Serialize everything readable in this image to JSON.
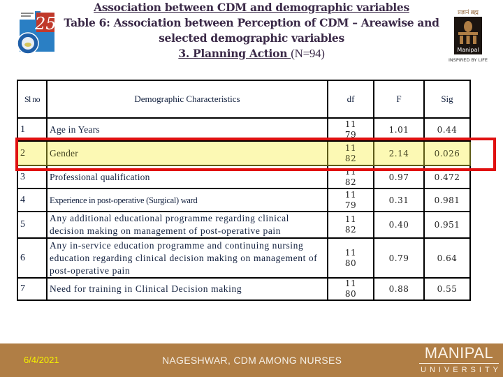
{
  "header": {
    "line1": "Association between CDM and demographic variables",
    "line2": "Table 6: Association between Perception of CDM – Areawise  and",
    "line3": "selected demographic variables",
    "line4_underlined": "3. Planning Action ",
    "line4_n": "(N=94)",
    "logo_left_number": "25",
    "logo_right_top": "प्रज्ञानं ब्रह्म",
    "logo_right_name": "Manipal",
    "logo_right_tagline": "INSPIRED BY LIFE"
  },
  "table": {
    "columns": [
      "Sl no",
      "Demographic Characteristics",
      "df",
      "F",
      "Sig"
    ],
    "rows": [
      {
        "sl": "1",
        "characteristic": "Age in Years",
        "df1": "11",
        "df2": "79",
        "F": "1.01",
        "sig": "0.44"
      },
      {
        "sl": "2",
        "characteristic": "Gender",
        "df1": "11",
        "df2": "82",
        "F": "2.14",
        "sig": "0.026",
        "highlighted": true
      },
      {
        "sl": "3",
        "characteristic": "Professional qualification",
        "df1": "11",
        "df2": "82",
        "F": "0.97",
        "sig": "0.472"
      },
      {
        "sl": "4",
        "characteristic": "Experience in post-operative (Surgical) ward",
        "df1": "11",
        "df2": "79",
        "F": "0.31",
        "sig": "0.981"
      },
      {
        "sl": "5",
        "characteristic": "Any additional educational programme regarding clinical decision making on management of post-operative pain",
        "df1": "11",
        "df2": "82",
        "F": "0.40",
        "sig": "0.951"
      },
      {
        "sl": "6",
        "characteristic": "Any in-service education programme and continuing nursing education regarding clinical decision making on management of post-operative pain",
        "df1": "11",
        "df2": "80",
        "F": "0.79",
        "sig": "0.64"
      },
      {
        "sl": "7",
        "characteristic": "Need for training in Clinical Decision making",
        "df1": "11",
        "df2": "80",
        "F": "0.88",
        "sig": "0.55"
      }
    ],
    "highlight_color": "#e01010",
    "highlight_fill": "#fcf9b4"
  },
  "footer": {
    "date": "6/4/2021",
    "text": "NAGESHWAR, CDM AMONG NURSES",
    "brand": "MANIPAL",
    "brand_sub": "UNIVERSITY",
    "background": "#b07e45"
  }
}
